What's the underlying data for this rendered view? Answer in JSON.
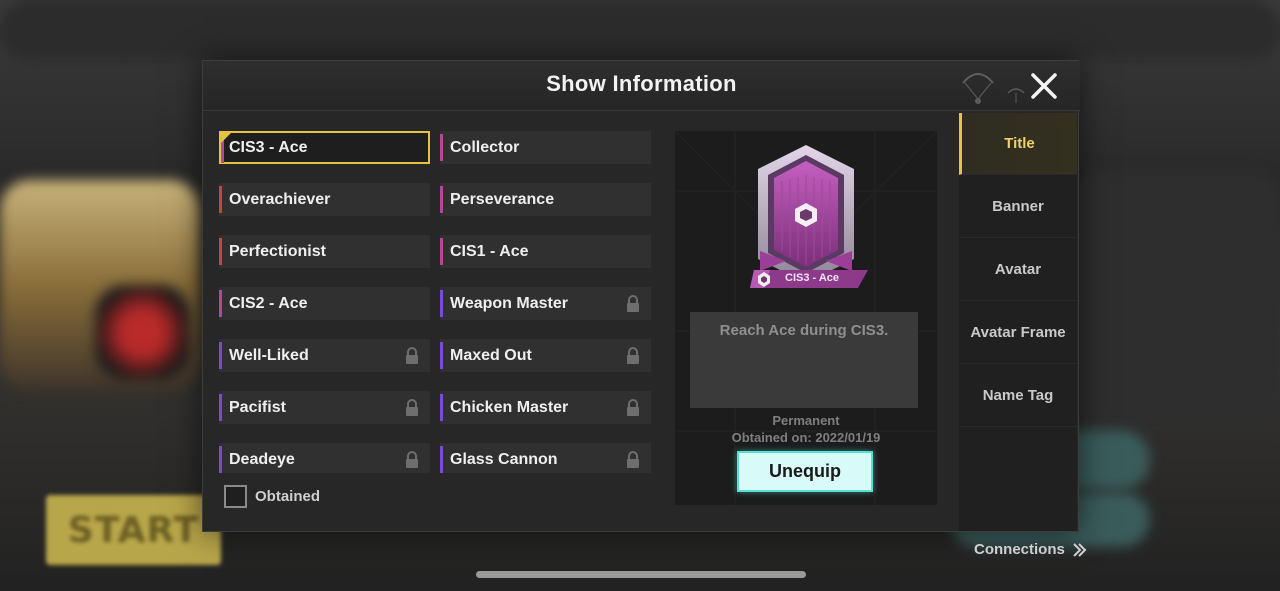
{
  "modal": {
    "title": "Show Information"
  },
  "titles": [
    {
      "label": "CIS3 - Ace",
      "color": "#b1489e",
      "locked": false,
      "selected": true
    },
    {
      "label": "Collector",
      "color": "#b1489e",
      "locked": false,
      "selected": false
    },
    {
      "label": "Overachiever",
      "color": "#c9453b",
      "locked": false,
      "selected": false
    },
    {
      "label": "Perseverance",
      "color": "#b1489e",
      "locked": false,
      "selected": false
    },
    {
      "label": "Perfectionist",
      "color": "#c9453b",
      "locked": false,
      "selected": false
    },
    {
      "label": "CIS1 - Ace",
      "color": "#b1489e",
      "locked": false,
      "selected": false
    },
    {
      "label": "CIS2 - Ace",
      "color": "#b1489e",
      "locked": false,
      "selected": false
    },
    {
      "label": "Weapon Master",
      "color": "#7b4bd6",
      "locked": true,
      "selected": false
    },
    {
      "label": "Well-Liked",
      "color": "#7b4bd6",
      "locked": true,
      "selected": false
    },
    {
      "label": "Maxed Out",
      "color": "#7b4bd6",
      "locked": true,
      "selected": false
    },
    {
      "label": "Pacifist",
      "color": "#7b4bd6",
      "locked": true,
      "selected": false
    },
    {
      "label": "Chicken Master",
      "color": "#7b4bd6",
      "locked": true,
      "selected": false
    },
    {
      "label": "Deadeye",
      "color": "#7b4bd6",
      "locked": true,
      "selected": false
    },
    {
      "label": "Glass Cannon",
      "color": "#7b4bd6",
      "locked": true,
      "selected": false
    }
  ],
  "filter": {
    "obtained_label": "Obtained",
    "obtained_checked": false
  },
  "preview": {
    "ribbon_label": "CIS3 - Ace",
    "description": "Reach Ace during CIS3.",
    "duration": "Permanent",
    "obtained_on": "Obtained on: 2022/01/19",
    "unequip_label": "Unequip"
  },
  "tabs": [
    {
      "label": "Title",
      "active": true
    },
    {
      "label": "Banner",
      "active": false
    },
    {
      "label": "Avatar",
      "active": false
    },
    {
      "label": "Avatar Frame",
      "active": false
    },
    {
      "label": "Name Tag",
      "active": false
    }
  ],
  "connections_label": "Connections",
  "background": {
    "start_label": "START"
  },
  "colors": {
    "selected_accent": "#e3c341",
    "unequip_bg": "#d9fbf8",
    "unequip_border": "#54e0d6",
    "emblem_purple": "#b1489e"
  }
}
